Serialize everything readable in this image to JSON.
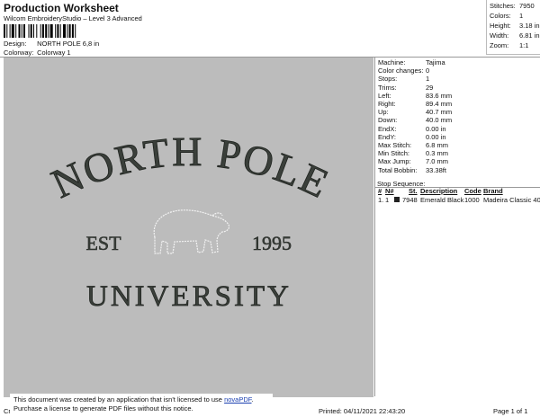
{
  "header": {
    "title": "Production Worksheet",
    "subtitle": "Wilcom EmbroideryStudio – Level 3 Advanced",
    "design_label": "Design:",
    "design_value": "NORTH POLE 6,8 in",
    "colorway_label": "Colorway:",
    "colorway_value": "Colorway 1"
  },
  "stats": [
    {
      "label": "Stitches:",
      "value": "7950"
    },
    {
      "label": "Colors:",
      "value": "1"
    },
    {
      "label": "Height:",
      "value": "3.18 in"
    },
    {
      "label": "Width:",
      "value": "6.81 in"
    },
    {
      "label": "Zoom:",
      "value": "1:1"
    }
  ],
  "machine_info": [
    {
      "label": "Machine:",
      "value": "Tajima"
    },
    {
      "label": "Color changes:",
      "value": "0"
    },
    {
      "label": "Stops:",
      "value": "1"
    },
    {
      "label": "Trims:",
      "value": "29"
    },
    {
      "label": "Left:",
      "value": "83.6 mm"
    },
    {
      "label": "Right:",
      "value": "89.4 mm"
    },
    {
      "label": "Up:",
      "value": "40.7 mm"
    },
    {
      "label": "Down:",
      "value": "40.0 mm"
    },
    {
      "label": "EndX:",
      "value": "0.00 in"
    },
    {
      "label": "EndY:",
      "value": "0.00 in"
    },
    {
      "label": "Max Stitch:",
      "value": "6.8 mm"
    },
    {
      "label": "Min Stitch:",
      "value": "0.3 mm"
    },
    {
      "label": "Max Jump:",
      "value": "7.0 mm"
    },
    {
      "label": "Total Bobbin:",
      "value": "33.38ft"
    }
  ],
  "stop_sequence": {
    "title": "Stop Sequence:",
    "headers": [
      "#",
      "N#",
      "St.",
      "Description",
      "Code",
      "Brand"
    ],
    "rows": [
      {
        "num": "1.",
        "n": "1",
        "st": "7948",
        "description": "Emerald Black",
        "code": "1000",
        "brand": "Madeira Classic 40",
        "color": "#222222"
      }
    ]
  },
  "design": {
    "line1": "NORTH POLE",
    "left_text": "EST",
    "right_text": "1995",
    "line3": "UNIVERSITY",
    "background": "#bcbcbc",
    "thread_color": "#3a3f3a"
  },
  "footer": {
    "left_code": "Cr",
    "notice_line1": "This document was created by an application that isn't licensed to use ",
    "notice_link": "novaPDF",
    "notice_line1_end": ".",
    "notice_line2": "Purchase a license to generate PDF files without this notice.",
    "printed": "Printed: 04/11/2021 22:43:20",
    "page": "Page 1 of 1"
  }
}
